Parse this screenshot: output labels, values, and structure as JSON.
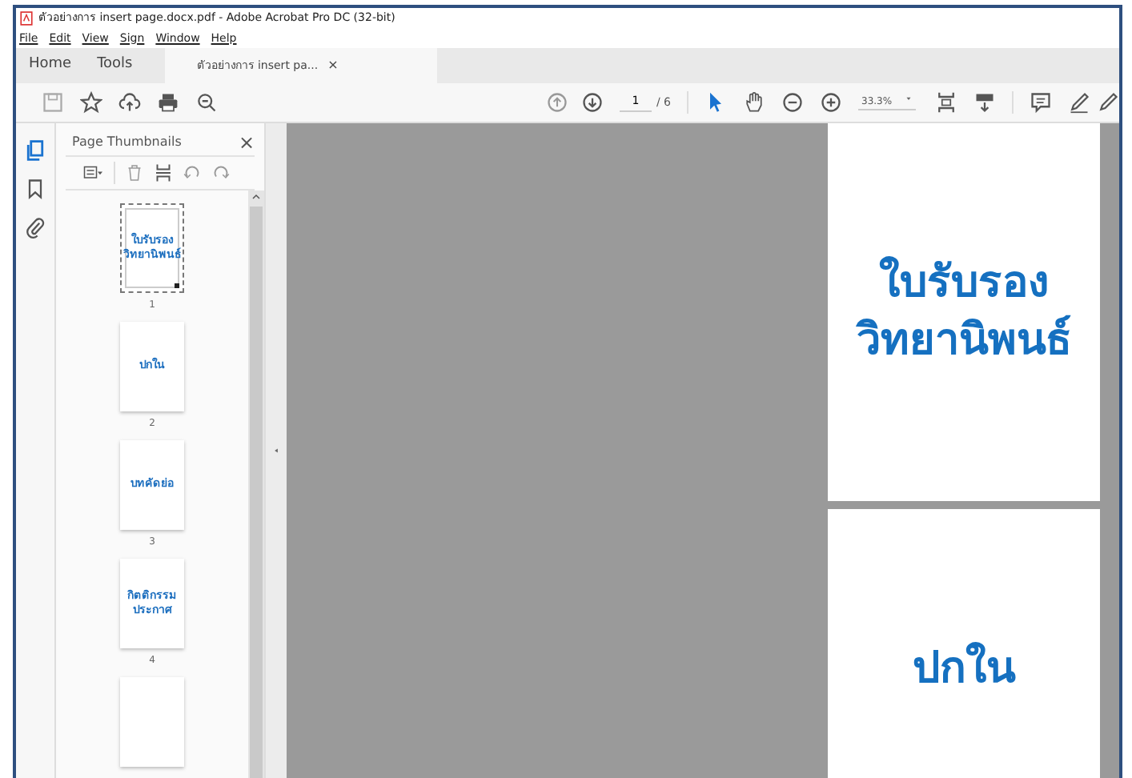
{
  "window": {
    "title": "ตัวอย่างการ insert page.docx.pdf - Adobe Acrobat Pro DC (32-bit)"
  },
  "menu": [
    "File",
    "Edit",
    "View",
    "Sign",
    "Window",
    "Help"
  ],
  "tabs": [
    {
      "label": "Home",
      "selected": false,
      "kind": "plain"
    },
    {
      "label": "Tools",
      "selected": false,
      "kind": "plain"
    },
    {
      "label": "ตัวอย่างการ insert pa...",
      "selected": true,
      "kind": "document",
      "close": "×"
    }
  ],
  "toolbar": {
    "page": "1",
    "page_count": "/ 6",
    "zoom": "33.3%"
  },
  "panel": {
    "title": "Page Thumbnails",
    "close": "×",
    "thumbnails": [
      {
        "lines": [
          "ใบรับรอง",
          "วิทยานิพนธ์"
        ],
        "label": "1",
        "selected": true
      },
      {
        "lines": [
          "ปกใน"
        ],
        "label": "2",
        "selected": false
      },
      {
        "lines": [
          "บทคัดย่อ"
        ],
        "label": "3",
        "selected": false
      },
      {
        "lines": [
          "กิตติกรรม",
          "ประกาศ"
        ],
        "label": "4",
        "selected": false
      },
      {
        "selected": false
      }
    ]
  },
  "pages": [
    {
      "lines": [
        "ใบรับรอง",
        "วิทยานิพนธ์"
      ]
    },
    {
      "lines": [
        "ปกใน"
      ]
    }
  ]
}
